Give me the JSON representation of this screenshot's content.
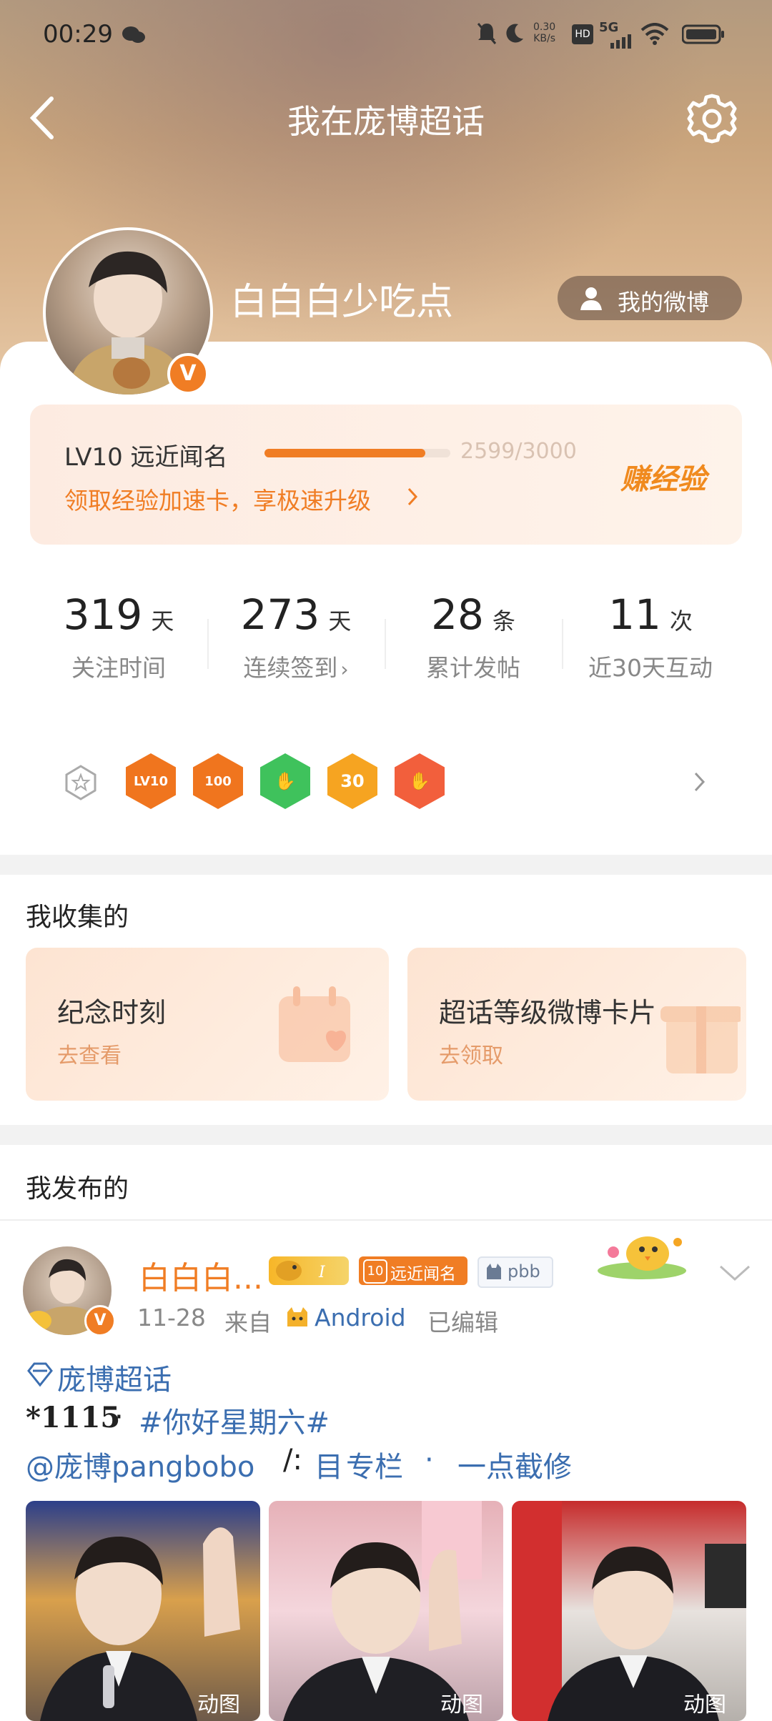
{
  "status_bar": {
    "time": "00:29",
    "speed": "0.30\nKB/s",
    "net": "5G"
  },
  "nav": {
    "title": "我在庞博超话"
  },
  "profile": {
    "name": "白白白少吃点",
    "my_weibo": "我的微博",
    "verified": "V"
  },
  "level": {
    "title": "LV10 远近闻名",
    "progress_text": "2599/3000",
    "progress": 0.866,
    "subtitle": "领取经验加速卡，享极速升级",
    "earn": "赚经验"
  },
  "stats": [
    {
      "value": "319",
      "unit": "天",
      "label": "关注时间"
    },
    {
      "value": "273",
      "unit": "天",
      "label": "连续签到"
    },
    {
      "value": "28",
      "unit": "条",
      "label": "累计发帖"
    },
    {
      "value": "11",
      "unit": "次",
      "label": "近30天互动"
    }
  ],
  "badges": [
    {
      "text": "LV10",
      "color": "#f0751e"
    },
    {
      "text": "100",
      "color": "#f0751e"
    },
    {
      "text": "✋",
      "color": "#3fc25c"
    },
    {
      "text": "30",
      "color": "#f6a421"
    },
    {
      "text": "✋",
      "color": "#f25f3c"
    }
  ],
  "collected": {
    "heading": "我收集的",
    "cards": [
      {
        "title": "纪念时刻",
        "action": "去查看"
      },
      {
        "title": "超话等级微博卡片",
        "action": "去领取"
      }
    ]
  },
  "published": {
    "heading": "我发布的"
  },
  "post": {
    "name": "白白白...",
    "fan_level": "10",
    "fan_title": "远近闻名",
    "tag": "pbb",
    "meta_date": "11-28",
    "meta_from": "来自",
    "meta_device": "Android",
    "meta_edited": "已编辑",
    "topic": "庞博超话",
    "line1_prefix": "*1115",
    "line1_dot": "·",
    "line1_tag": "#你好星期六#",
    "mention": "@庞博pangbobo",
    "line3_sep": "/:",
    "column_icon": "目",
    "column": "专栏",
    "column_dot": "·",
    "column_extra": "一点截修",
    "images": [
      {
        "label": "动图"
      },
      {
        "label": "动图"
      },
      {
        "label": "动图"
      }
    ]
  },
  "colors": {
    "accent": "#f07d24",
    "link": "#3b6eb0"
  }
}
